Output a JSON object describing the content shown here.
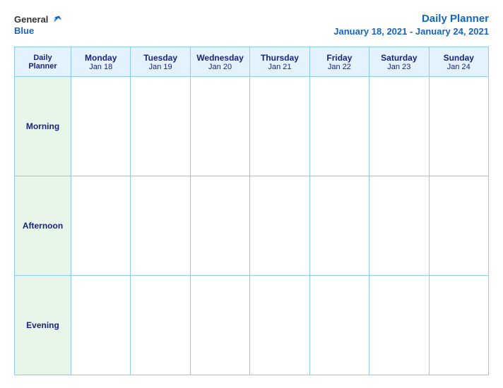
{
  "header": {
    "logo_general": "General",
    "logo_blue": "Blue",
    "planner_title": "Daily Planner",
    "date_range": "January 18, 2021 - January 24, 2021"
  },
  "table": {
    "header_label": "Daily\nPlanner",
    "days": [
      {
        "name": "Monday",
        "date": "Jan 18"
      },
      {
        "name": "Tuesday",
        "date": "Jan 19"
      },
      {
        "name": "Wednesday",
        "date": "Jan 20"
      },
      {
        "name": "Thursday",
        "date": "Jan 21"
      },
      {
        "name": "Friday",
        "date": "Jan 22"
      },
      {
        "name": "Saturday",
        "date": "Jan 23"
      },
      {
        "name": "Sunday",
        "date": "Jan 24"
      }
    ],
    "rows": [
      {
        "label": "Morning"
      },
      {
        "label": "Afternoon"
      },
      {
        "label": "Evening"
      }
    ]
  }
}
